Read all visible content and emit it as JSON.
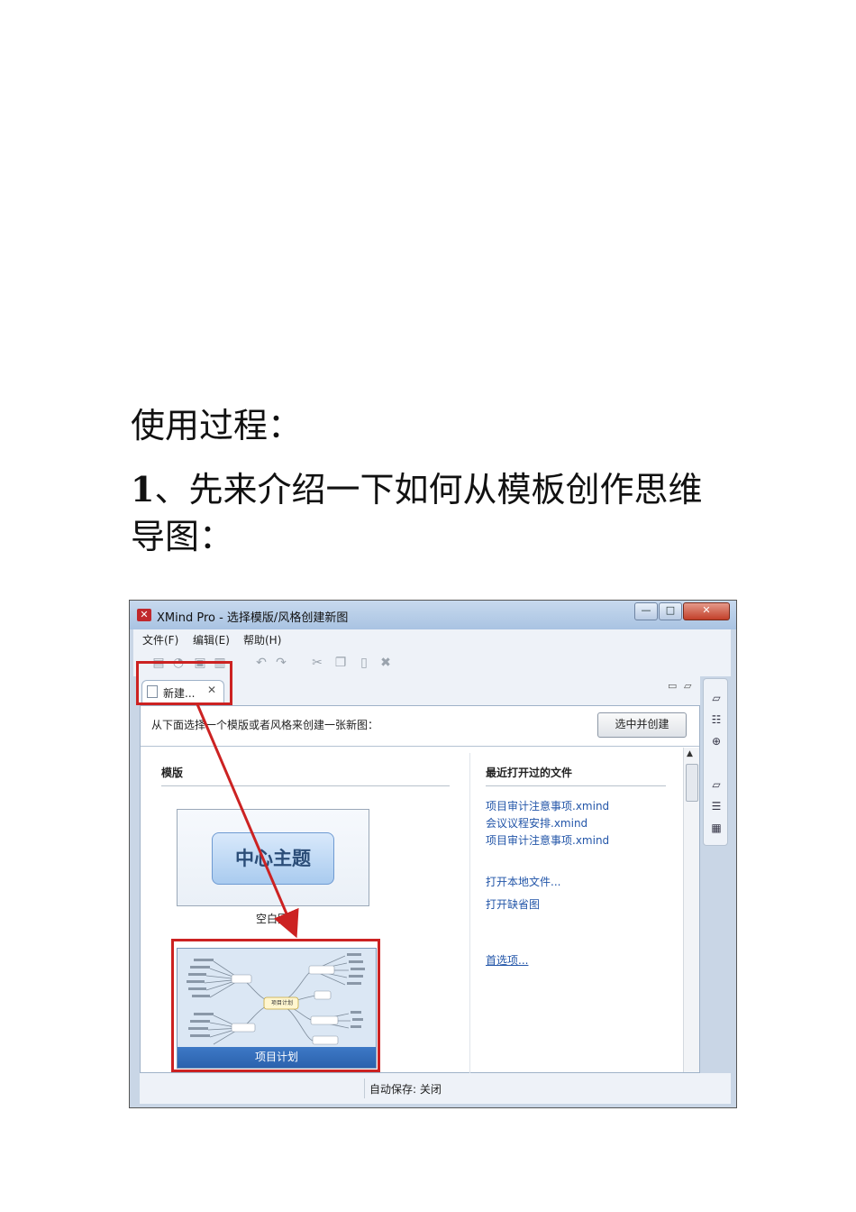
{
  "doc": {
    "heading1": "使用过程：",
    "heading2_num": "1",
    "heading2_text": "、先来介绍一下如何从模板创作思维导图："
  },
  "window": {
    "title": "XMind Pro - 选择模版/风格创建新图",
    "min": "—",
    "max": "□",
    "close": "✕"
  },
  "menu": [
    "文件(F)",
    "编辑(E)",
    "帮助(H)"
  ],
  "tab": {
    "label": "新建...",
    "close": "✕"
  },
  "dialog": {
    "hint": "从下面选择一个模版或者风格来创建一张新图：",
    "create_button": "选中并创建",
    "templates_label": "模版",
    "blank_central": "中心主题",
    "blank_caption": "空白图",
    "project_caption": "项目计划",
    "project_center": "项目计划",
    "recent_label": "最近打开过的文件",
    "recent_files": [
      "项目审计注意事项.xmind",
      "会议议程安排.xmind",
      "项目审计注意事项.xmind"
    ],
    "open_local": "打开本地文件...",
    "open_sample": "打开缺省图",
    "preferences": "首选项..."
  },
  "status": {
    "autosave": "自动保存: 关闭"
  },
  "colors": {
    "highlight": "#cc2222",
    "link": "#2255a8",
    "accent": "#2b62ad"
  }
}
